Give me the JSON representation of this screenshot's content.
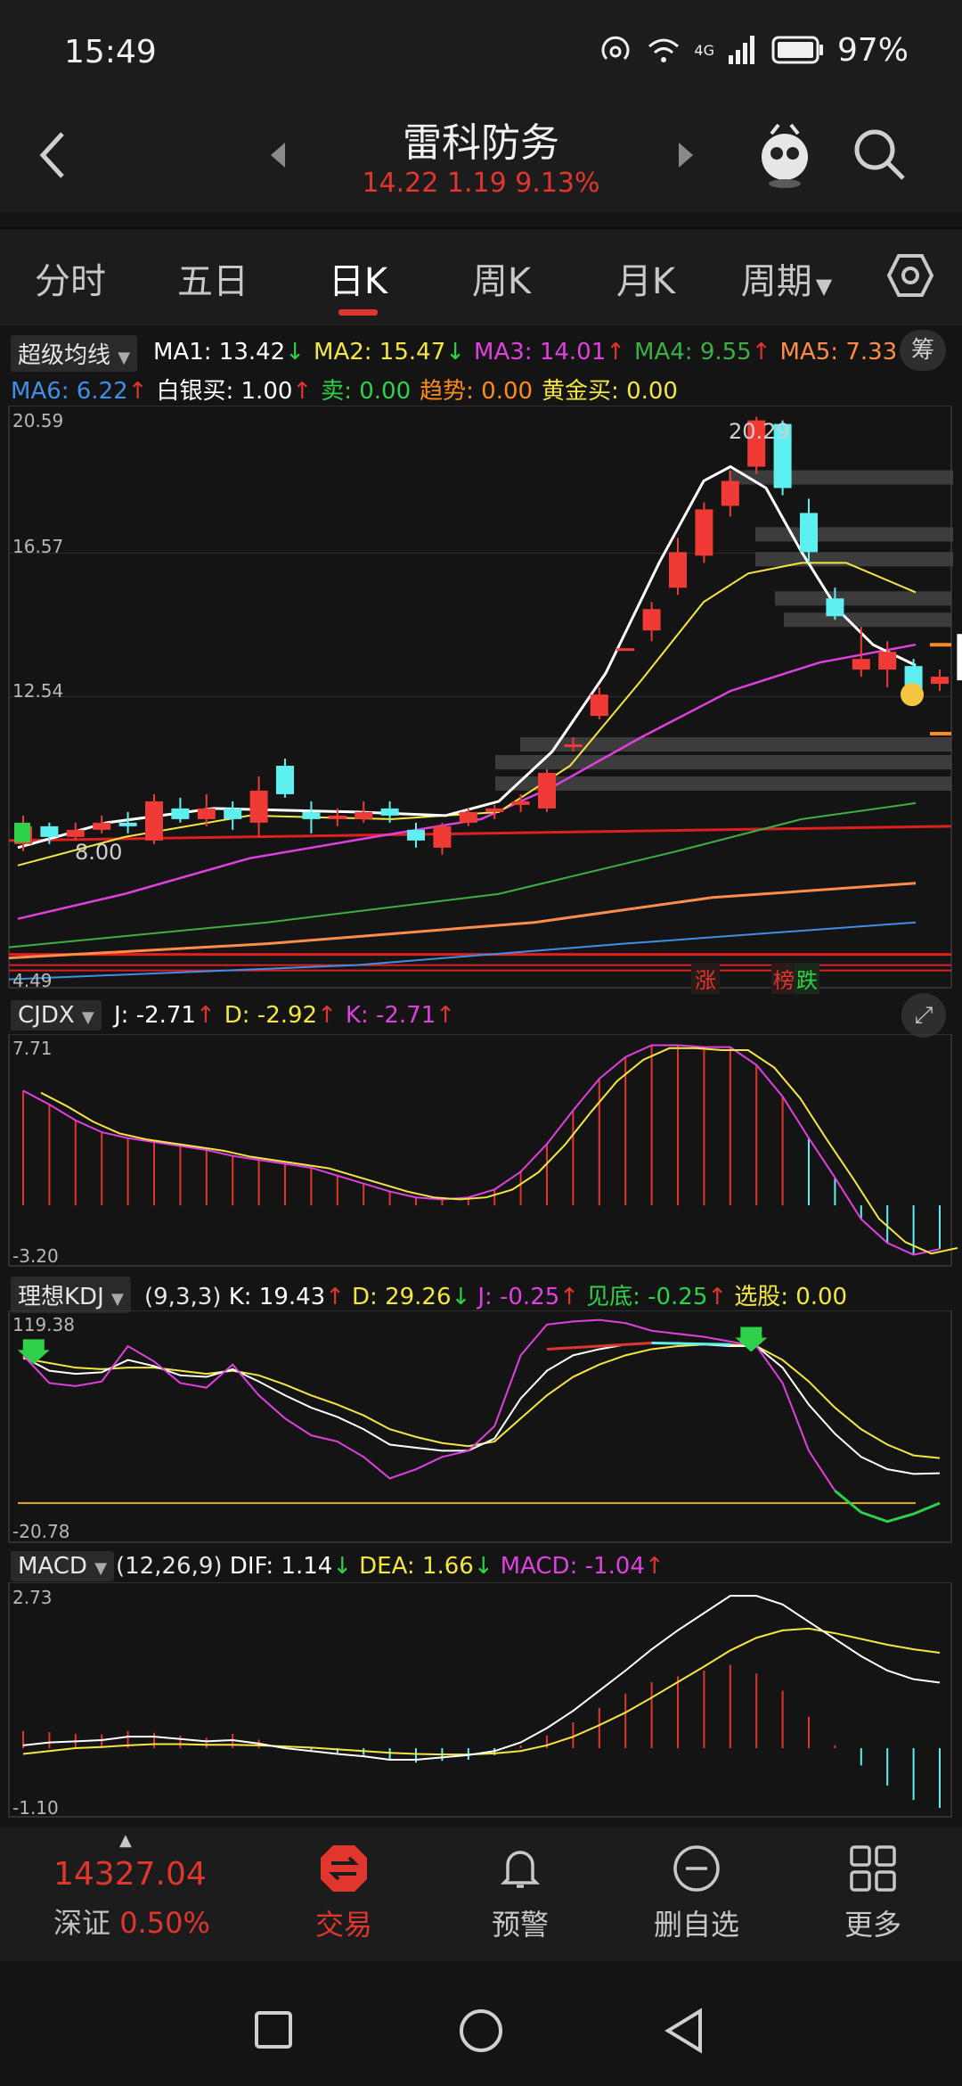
{
  "status": {
    "time": "15:49",
    "battery": "97%",
    "network": "4G"
  },
  "header": {
    "title": "雷科防务",
    "price_line": "14.22  1.19  9.13%"
  },
  "tabs": [
    {
      "label": "分时"
    },
    {
      "label": "五日"
    },
    {
      "label": "日K"
    },
    {
      "label": "周K"
    },
    {
      "label": "月K"
    },
    {
      "label": "周期"
    }
  ],
  "active_tab": "日K",
  "main_panel": {
    "indicator": "超级均线",
    "ma_line1": [
      {
        "text": "MA1: 13.42",
        "color": "#ffffff",
        "arrow": "↓",
        "arrow_color": "#2fd14a"
      },
      {
        "text": "MA2: 15.47",
        "color": "#f5e642",
        "arrow": "↓",
        "arrow_color": "#2fd14a"
      },
      {
        "text": "MA3: 14.01",
        "color": "#e040e0",
        "arrow": "↑",
        "arrow_color": "#e0362e"
      },
      {
        "text": "MA4: 9.55",
        "color": "#3cb043",
        "arrow": "↑",
        "arrow_color": "#e0362e"
      },
      {
        "text": "MA5: 7.33",
        "color": "#ff8c4a",
        "arrow": "↑",
        "arrow_color": "#e0362e"
      }
    ],
    "ma_line2": [
      {
        "text": "MA6: 6.22",
        "color": "#3f8fe8",
        "arrow": "↑",
        "arrow_color": "#e0362e"
      },
      {
        "text": "白银买: 1.00",
        "color": "#ffffff",
        "arrow": "↑",
        "arrow_color": "#e0362e"
      },
      {
        "text": "卖: 0.00",
        "color": "#2fd14a",
        "arrow": "",
        "arrow_color": ""
      },
      {
        "text": "趋势: 0.00",
        "color": "#ff8c1a",
        "arrow": "",
        "arrow_color": ""
      },
      {
        "text": "黄金买: 0.00",
        "color": "#f5e642",
        "arrow": "",
        "arrow_color": ""
      }
    ],
    "right_badge": "筹",
    "y_top": "20.59",
    "y_mid1": "16.57",
    "y_mid2": "12.54",
    "y_bottom": "4.49",
    "high_label": "20.29",
    "low_label": "8.00",
    "tag_up": "涨",
    "tag_list": "榜",
    "tag_down": "跌"
  },
  "cjdx_panel": {
    "indicator": "CJDX",
    "values": [
      {
        "text": "J: -2.71",
        "color": "#ffffff",
        "arrow": "↑",
        "arrow_color": "#e0362e"
      },
      {
        "text": "D: -2.92",
        "color": "#f5e642",
        "arrow": "↑",
        "arrow_color": "#e0362e"
      },
      {
        "text": "K: -2.71",
        "color": "#e040e0",
        "arrow": "↑",
        "arrow_color": "#e0362e"
      }
    ],
    "y_top": "7.71",
    "y_bottom": "-3.20"
  },
  "kdj_panel": {
    "indicator": "理想KDJ",
    "params": "(9,3,3)",
    "values": [
      {
        "text": "K: 19.43",
        "color": "#ffffff",
        "arrow": "↑",
        "arrow_color": "#e0362e"
      },
      {
        "text": "D: 29.26",
        "color": "#f5e642",
        "arrow": "↓",
        "arrow_color": "#2fd14a"
      },
      {
        "text": "J: -0.25",
        "color": "#e040e0",
        "arrow": "↑",
        "arrow_color": "#e0362e"
      },
      {
        "text": "见底: -0.25",
        "color": "#2fd14a",
        "arrow": "↑",
        "arrow_color": "#e0362e"
      },
      {
        "text": "选股: 0.00",
        "color": "#f5e642",
        "arrow": "",
        "arrow_color": ""
      }
    ],
    "y_top": "119.38",
    "y_bottom": "-20.78"
  },
  "macd_panel": {
    "indicator": "MACD",
    "params": "(12,26,9)",
    "values": [
      {
        "text": "DIF: 1.14",
        "color": "#ffffff",
        "arrow": "↓",
        "arrow_color": "#2fd14a"
      },
      {
        "text": "DEA: 1.66",
        "color": "#f5e642",
        "arrow": "↓",
        "arrow_color": "#2fd14a"
      },
      {
        "text": "MACD: -1.04",
        "color": "#e040e0",
        "arrow": "↑",
        "arrow_color": "#e0362e"
      }
    ],
    "y_top": "2.73",
    "y_bottom": "-1.10"
  },
  "bottom_nav": {
    "index_value": "14327.04",
    "index_name": "深证",
    "index_pct": "0.50%",
    "items": [
      {
        "label": "交易",
        "icon": "trade-icon"
      },
      {
        "label": "预警",
        "icon": "bell-icon"
      },
      {
        "label": "删自选",
        "icon": "remove-watchlist-icon"
      },
      {
        "label": "更多",
        "icon": "grid-icon"
      }
    ]
  },
  "colors": {
    "up": "#f03a36",
    "down": "#5ef0f0",
    "accent": "#e0362e"
  },
  "chart_data": {
    "type": "candlestick",
    "candles": [
      {
        "o": 8.4,
        "c": 8.9,
        "h": 9.2,
        "l": 8.2
      },
      {
        "o": 8.9,
        "c": 8.6,
        "h": 9.0,
        "l": 8.4
      },
      {
        "o": 8.6,
        "c": 8.8,
        "h": 9.0,
        "l": 8.5
      },
      {
        "o": 8.8,
        "c": 9.0,
        "h": 9.2,
        "l": 8.7
      },
      {
        "o": 9.0,
        "c": 8.9,
        "h": 9.3,
        "l": 8.7
      },
      {
        "o": 8.5,
        "c": 9.6,
        "h": 9.8,
        "l": 8.4
      },
      {
        "o": 9.4,
        "c": 9.1,
        "h": 9.7,
        "l": 9.0
      },
      {
        "o": 9.1,
        "c": 9.4,
        "h": 9.8,
        "l": 8.9
      },
      {
        "o": 9.4,
        "c": 9.1,
        "h": 9.6,
        "l": 8.8
      },
      {
        "o": 9.0,
        "c": 9.9,
        "h": 10.3,
        "l": 8.6
      },
      {
        "o": 10.6,
        "c": 9.8,
        "h": 10.8,
        "l": 9.7
      },
      {
        "o": 9.3,
        "c": 9.1,
        "h": 9.6,
        "l": 8.7
      },
      {
        "o": 9.1,
        "c": 9.2,
        "h": 9.4,
        "l": 8.9
      },
      {
        "o": 9.1,
        "c": 9.3,
        "h": 9.6,
        "l": 9.0
      },
      {
        "o": 9.4,
        "c": 9.2,
        "h": 9.6,
        "l": 9.0
      },
      {
        "o": 8.8,
        "c": 8.5,
        "h": 9.0,
        "l": 8.3
      },
      {
        "o": 8.3,
        "c": 8.9,
        "h": 9.0,
        "l": 8.1
      },
      {
        "o": 9.0,
        "c": 9.3,
        "h": 9.4,
        "l": 8.9
      },
      {
        "o": 9.3,
        "c": 9.4,
        "h": 9.5,
        "l": 9.1
      },
      {
        "o": 9.5,
        "c": 9.6,
        "h": 9.8,
        "l": 9.3
      },
      {
        "o": 9.4,
        "c": 10.4,
        "h": 10.5,
        "l": 9.3
      },
      {
        "o": 11.2,
        "c": 11.2,
        "h": 11.4,
        "l": 11.0
      },
      {
        "o": 12.0,
        "c": 12.6,
        "h": 12.8,
        "l": 11.9
      },
      {
        "o": 13.9,
        "c": 13.9,
        "h": 13.9,
        "l": 13.9
      },
      {
        "o": 14.4,
        "c": 15.0,
        "h": 15.2,
        "l": 14.1
      },
      {
        "o": 15.6,
        "c": 16.6,
        "h": 17.0,
        "l": 15.4
      },
      {
        "o": 16.5,
        "c": 17.8,
        "h": 18.0,
        "l": 16.3
      },
      {
        "o": 17.9,
        "c": 18.6,
        "h": 18.9,
        "l": 17.6
      },
      {
        "o": 19.0,
        "c": 20.3,
        "h": 20.4,
        "l": 18.8
      },
      {
        "o": 20.2,
        "c": 18.4,
        "h": 20.3,
        "l": 18.2
      },
      {
        "o": 17.7,
        "c": 16.6,
        "h": 18.1,
        "l": 16.3
      },
      {
        "o": 15.3,
        "c": 14.8,
        "h": 15.6,
        "l": 14.7
      },
      {
        "o": 13.3,
        "c": 13.6,
        "h": 14.5,
        "l": 13.1
      },
      {
        "o": 13.3,
        "c": 13.8,
        "h": 14.1,
        "l": 12.8
      },
      {
        "o": 13.4,
        "c": 12.6,
        "h": 13.6,
        "l": 12.3
      },
      {
        "o": 12.9,
        "c": 13.1,
        "h": 13.3,
        "l": 12.7
      },
      {
        "o": 13.0,
        "c": 14.22,
        "h": 14.3,
        "l": 12.9
      }
    ],
    "ylim": [
      4.49,
      20.59
    ]
  }
}
